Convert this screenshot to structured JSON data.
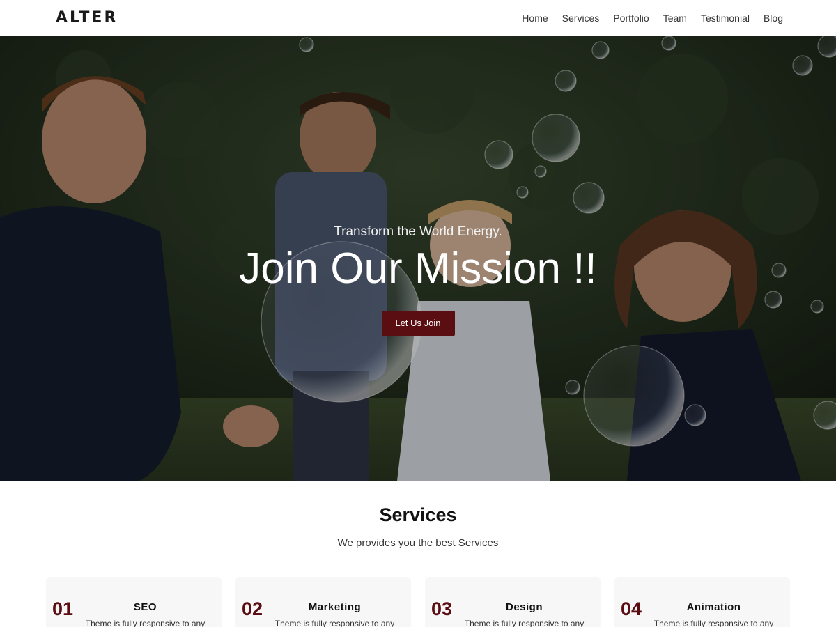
{
  "header": {
    "logo": "ALTER",
    "nav": [
      "Home",
      "Services",
      "Portfolio",
      "Team",
      "Testimonial",
      "Blog"
    ]
  },
  "hero": {
    "subtitle": "Transform the World Energy.",
    "title": "Join Our Mission !!",
    "button_label": "Let Us Join"
  },
  "services": {
    "title": "Services",
    "subtitle": "We provides you the best Services",
    "cards": [
      {
        "number": "01",
        "title": "SEO",
        "text": "Theme is fully responsive to any"
      },
      {
        "number": "02",
        "title": "Marketing",
        "text": "Theme is fully responsive to any"
      },
      {
        "number": "03",
        "title": "Design",
        "text": "Theme is fully responsive to any"
      },
      {
        "number": "04",
        "title": "Animation",
        "text": "Theme is fully responsive to any"
      }
    ]
  },
  "colors": {
    "accent": "#5a0e12",
    "header_bg": "#ffffff",
    "card_bg": "#f7f7f7"
  }
}
